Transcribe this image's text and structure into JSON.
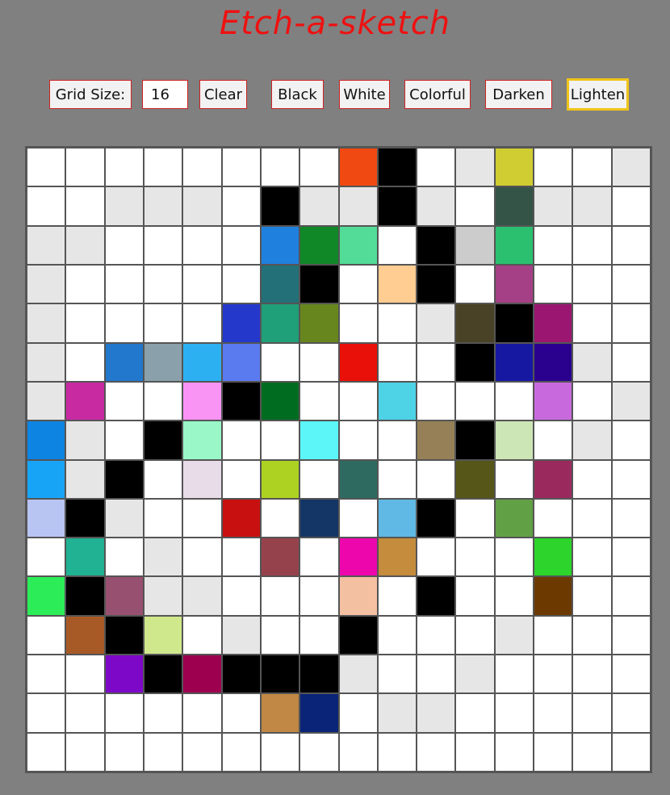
{
  "title": "Etch-a-sketch",
  "controls": {
    "grid_size_label": "Grid Size:",
    "grid_size_value": "16",
    "clear": "Clear",
    "black": "Black",
    "white": "White",
    "colorful": "Colorful",
    "darken": "Darken",
    "lighten": "Lighten",
    "active_mode": "Lighten"
  },
  "grid": {
    "size": 16,
    "cells": [
      [
        "#ffffff",
        "#ffffff",
        "#ffffff",
        "#ffffff",
        "#ffffff",
        "#ffffff",
        "#ffffff",
        "#ffffff",
        "#f04a12",
        "#000000",
        "#ffffff",
        "#e6e6e6",
        "#d0cd32",
        "#ffffff",
        "#ffffff",
        "#e6e6e6"
      ],
      [
        "#ffffff",
        "#ffffff",
        "#e6e6e6",
        "#e6e6e6",
        "#e6e6e6",
        "#ffffff",
        "#000000",
        "#e6e6e6",
        "#e6e6e6",
        "#000000",
        "#e6e6e6",
        "#ffffff",
        "#355448",
        "#e6e6e6",
        "#e6e6e6",
        "#ffffff"
      ],
      [
        "#e6e6e6",
        "#e6e6e6",
        "#ffffff",
        "#ffffff",
        "#ffffff",
        "#ffffff",
        "#2080de",
        "#118828",
        "#52dc98",
        "#ffffff",
        "#000000",
        "#cccccc",
        "#2bc070",
        "#ffffff",
        "#ffffff",
        "#ffffff"
      ],
      [
        "#e6e6e6",
        "#ffffff",
        "#ffffff",
        "#ffffff",
        "#ffffff",
        "#ffffff",
        "#237078",
        "#000000",
        "#ffffff",
        "#ffcc92",
        "#000000",
        "#ffffff",
        "#a54086",
        "#ffffff",
        "#ffffff",
        "#ffffff"
      ],
      [
        "#e6e6e6",
        "#ffffff",
        "#ffffff",
        "#ffffff",
        "#ffffff",
        "#2438cc",
        "#20a078",
        "#68861e",
        "#ffffff",
        "#ffffff",
        "#e6e6e6",
        "#4a4226",
        "#000000",
        "#9a1670",
        "#ffffff",
        "#ffffff"
      ],
      [
        "#e6e6e6",
        "#ffffff",
        "#2278cc",
        "#8aa0aa",
        "#2cb0f2",
        "#5a7af0",
        "#ffffff",
        "#ffffff",
        "#e81008",
        "#ffffff",
        "#ffffff",
        "#000000",
        "#1618a2",
        "#2a008e",
        "#e6e6e6",
        "#ffffff"
      ],
      [
        "#e6e6e6",
        "#c82aa2",
        "#ffffff",
        "#ffffff",
        "#fa94f4",
        "#000000",
        "#006c20",
        "#ffffff",
        "#ffffff",
        "#4ed2e6",
        "#ffffff",
        "#ffffff",
        "#ffffff",
        "#c86ade",
        "#ffffff",
        "#e6e6e6"
      ],
      [
        "#0e84e2",
        "#e6e6e6",
        "#ffffff",
        "#000000",
        "#9af8c8",
        "#ffffff",
        "#ffffff",
        "#5cf6f8",
        "#ffffff",
        "#ffffff",
        "#968058",
        "#000000",
        "#cce6b6",
        "#ffffff",
        "#e6e6e6",
        "#ffffff"
      ],
      [
        "#18a4f6",
        "#e6e6e6",
        "#000000",
        "#ffffff",
        "#e8dce8",
        "#ffffff",
        "#aed222",
        "#ffffff",
        "#2e6a60",
        "#ffffff",
        "#ffffff",
        "#565618",
        "#ffffff",
        "#9a2a5e",
        "#ffffff",
        "#ffffff"
      ],
      [
        "#b8c4f2",
        "#000000",
        "#e6e6e6",
        "#ffffff",
        "#ffffff",
        "#c81010",
        "#ffffff",
        "#143666",
        "#ffffff",
        "#60b8e4",
        "#000000",
        "#ffffff",
        "#62a046",
        "#ffffff",
        "#ffffff",
        "#ffffff"
      ],
      [
        "#ffffff",
        "#20b292",
        "#ffffff",
        "#e6e6e6",
        "#ffffff",
        "#ffffff",
        "#96424c",
        "#ffffff",
        "#ec06ac",
        "#c48c3c",
        "#ffffff",
        "#ffffff",
        "#ffffff",
        "#2cd42c",
        "#ffffff",
        "#ffffff"
      ],
      [
        "#2ced58",
        "#000000",
        "#985070",
        "#e6e6e6",
        "#e6e6e6",
        "#ffffff",
        "#ffffff",
        "#ffffff",
        "#f4c0a2",
        "#ffffff",
        "#000000",
        "#ffffff",
        "#ffffff",
        "#6c3a00",
        "#ffffff",
        "#ffffff"
      ],
      [
        "#ffffff",
        "#a85a26",
        "#000000",
        "#d0e88c",
        "#ffffff",
        "#e6e6e6",
        "#ffffff",
        "#ffffff",
        "#000000",
        "#ffffff",
        "#ffffff",
        "#ffffff",
        "#e6e6e6",
        "#ffffff",
        "#ffffff",
        "#ffffff"
      ],
      [
        "#ffffff",
        "#ffffff",
        "#7e08c8",
        "#000000",
        "#9c004e",
        "#000000",
        "#000000",
        "#000000",
        "#e6e6e6",
        "#ffffff",
        "#ffffff",
        "#e6e6e6",
        "#ffffff",
        "#ffffff",
        "#ffffff",
        "#ffffff"
      ],
      [
        "#ffffff",
        "#ffffff",
        "#ffffff",
        "#ffffff",
        "#ffffff",
        "#ffffff",
        "#c08844",
        "#0a2478",
        "#ffffff",
        "#e6e6e6",
        "#e6e6e6",
        "#ffffff",
        "#ffffff",
        "#ffffff",
        "#ffffff",
        "#ffffff"
      ],
      [
        "#ffffff",
        "#ffffff",
        "#ffffff",
        "#ffffff",
        "#ffffff",
        "#ffffff",
        "#ffffff",
        "#ffffff",
        "#ffffff",
        "#ffffff",
        "#ffffff",
        "#ffffff",
        "#ffffff",
        "#ffffff",
        "#ffffff",
        "#ffffff"
      ]
    ]
  }
}
